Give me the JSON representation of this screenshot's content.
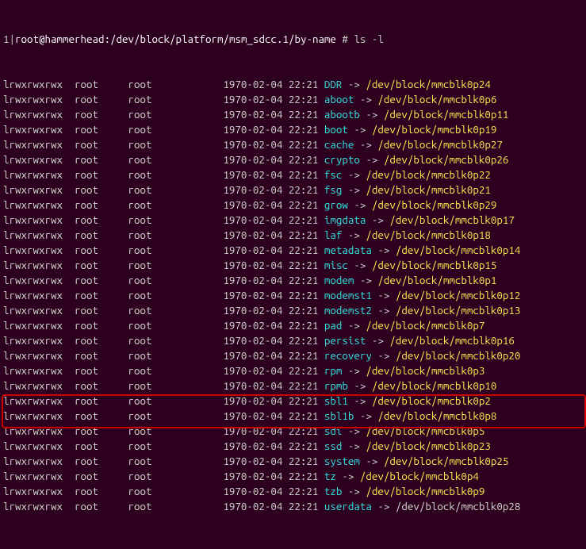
{
  "prompt": {
    "prefix": "1|",
    "user_host": "root@hammerhead",
    "path": ":/dev/block/platform/msm_sdcc.1/by-name",
    "hash": " # ",
    "command": "ls -l"
  },
  "defaults": {
    "perms": "lrwxrwxrwx",
    "owner": "root",
    "group": "root",
    "date": "1970-02-04",
    "time": "22:21",
    "arrow": "->"
  },
  "entries": [
    {
      "name": "DDR",
      "target": "/dev/block/mmcblk0p24"
    },
    {
      "name": "aboot",
      "target": "/dev/block/mmcblk0p6"
    },
    {
      "name": "abootb",
      "target": "/dev/block/mmcblk0p11"
    },
    {
      "name": "boot",
      "target": "/dev/block/mmcblk0p19"
    },
    {
      "name": "cache",
      "target": "/dev/block/mmcblk0p27"
    },
    {
      "name": "crypto",
      "target": "/dev/block/mmcblk0p26"
    },
    {
      "name": "fsc",
      "target": "/dev/block/mmcblk0p22"
    },
    {
      "name": "fsg",
      "target": "/dev/block/mmcblk0p21"
    },
    {
      "name": "grow",
      "target": "/dev/block/mmcblk0p29"
    },
    {
      "name": "imgdata",
      "target": "/dev/block/mmcblk0p17"
    },
    {
      "name": "laf",
      "target": "/dev/block/mmcblk0p18"
    },
    {
      "name": "metadata",
      "target": "/dev/block/mmcblk0p14"
    },
    {
      "name": "misc",
      "target": "/dev/block/mmcblk0p15"
    },
    {
      "name": "modem",
      "target": "/dev/block/mmcblk0p1"
    },
    {
      "name": "modemst1",
      "target": "/dev/block/mmcblk0p12"
    },
    {
      "name": "modemst2",
      "target": "/dev/block/mmcblk0p13"
    },
    {
      "name": "pad",
      "target": "/dev/block/mmcblk0p7"
    },
    {
      "name": "persist",
      "target": "/dev/block/mmcblk0p16"
    },
    {
      "name": "recovery",
      "target": "/dev/block/mmcblk0p20"
    },
    {
      "name": "rpm",
      "target": "/dev/block/mmcblk0p3"
    },
    {
      "name": "rpmb",
      "target": "/dev/block/mmcblk0p10"
    },
    {
      "name": "sbl1",
      "target": "/dev/block/mmcblk0p2"
    },
    {
      "name": "sbl1b",
      "target": "/dev/block/mmcblk0p8"
    },
    {
      "name": "sdi",
      "target": "/dev/block/mmcblk0p5"
    },
    {
      "name": "ssd",
      "target": "/dev/block/mmcblk0p23"
    },
    {
      "name": "system",
      "target": "/dev/block/mmcblk0p25"
    },
    {
      "name": "tz",
      "target": "/dev/block/mmcblk0p4",
      "highlighted": true
    },
    {
      "name": "tzb",
      "target": "/dev/block/mmcblk0p9",
      "highlighted": true
    },
    {
      "name": "userdata",
      "target": "/dev/block/mmcblk0p28",
      "plain_target": true
    }
  ]
}
